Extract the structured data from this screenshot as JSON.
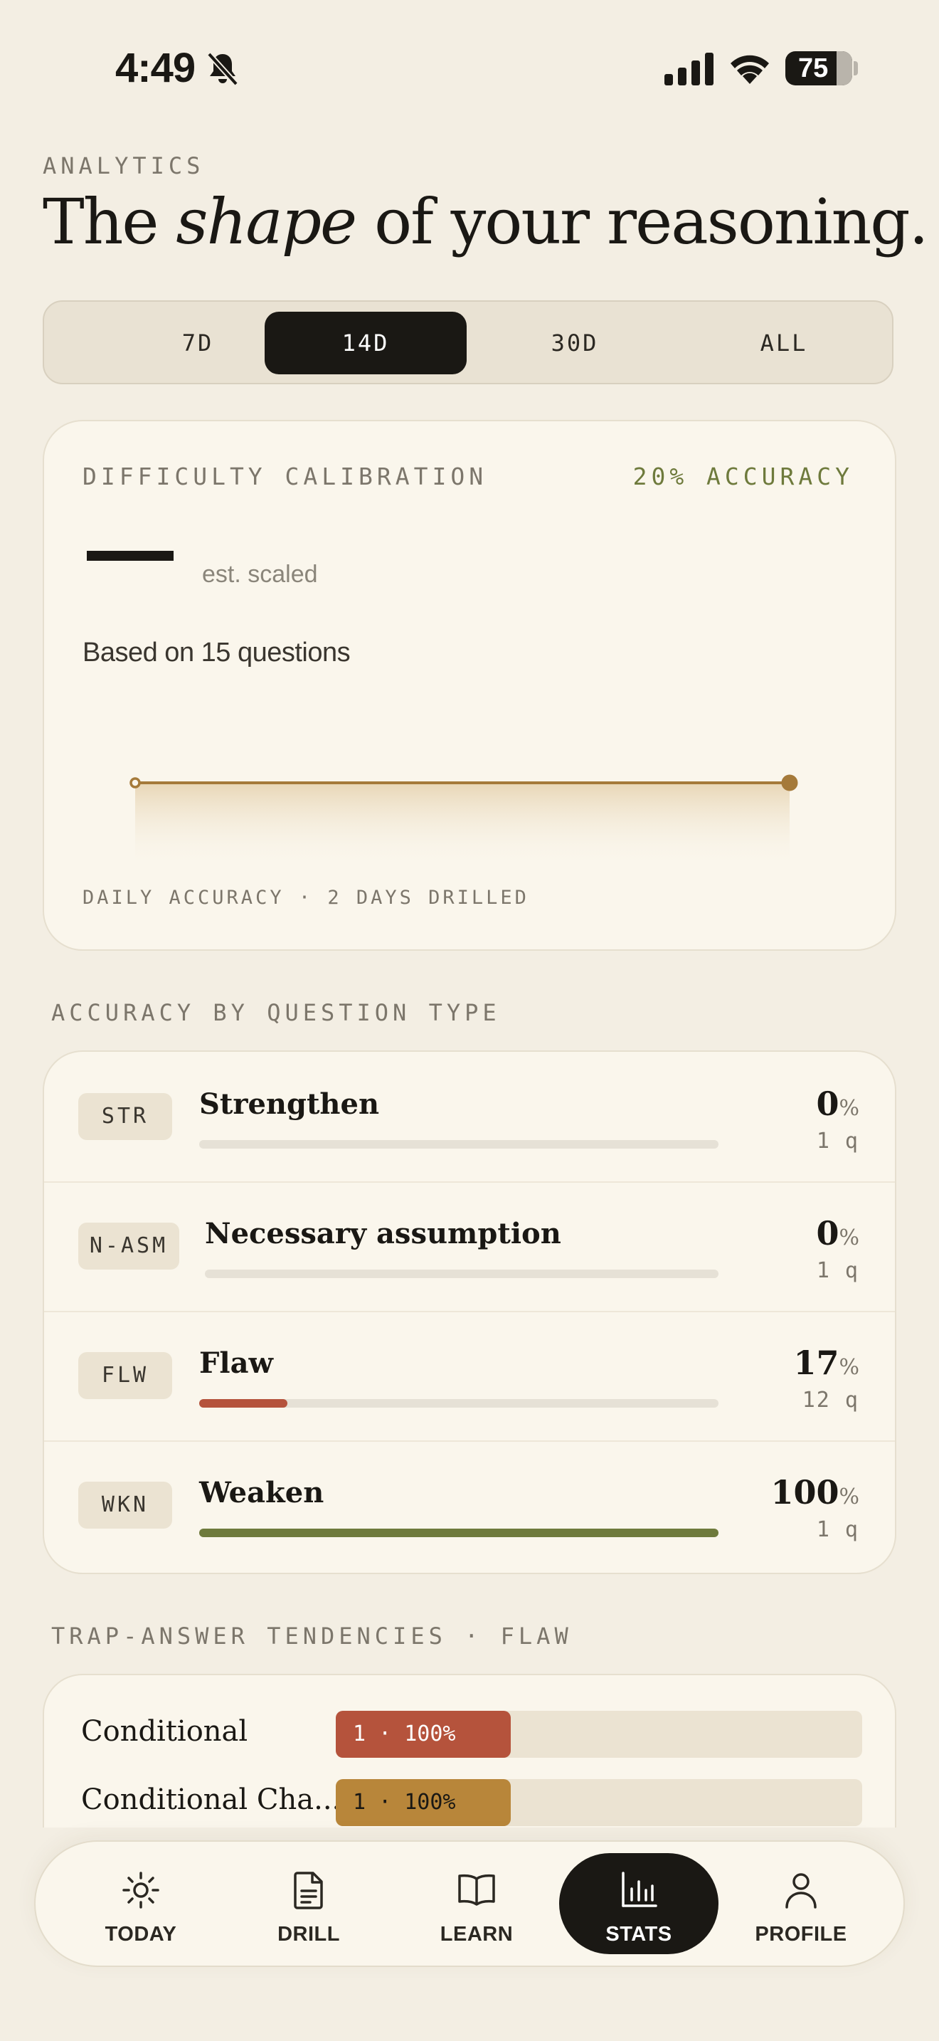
{
  "status_bar": {
    "time": "4:49",
    "battery": "75"
  },
  "header": {
    "eyebrow": "ANALYTICS",
    "title_before": "The ",
    "title_emph": "shape",
    "title_after": " of your reasoning."
  },
  "range_tabs": [
    {
      "label": "7D",
      "active": false
    },
    {
      "label": "14D",
      "active": true
    },
    {
      "label": "30D",
      "active": false
    },
    {
      "label": "ALL",
      "active": false
    }
  ],
  "calibration": {
    "label": "DIFFICULTY CALIBRATION",
    "accuracy": "20% ACCURACY",
    "est_label": "est. scaled",
    "based_on": "Based on 15 questions",
    "footer": "DAILY ACCURACY · 2 DAYS DRILLED",
    "chart_color": "#a57a3a"
  },
  "chart_data": {
    "type": "area",
    "x": [
      "day 1",
      "day 2"
    ],
    "series": [
      {
        "values": [
          20,
          20
        ]
      }
    ],
    "xlabel": "DAILY ACCURACY · 2 DAYS DRILLED",
    "grid": false
  },
  "question_types": {
    "section_label": "ACCURACY BY QUESTION TYPE",
    "rows": [
      {
        "tag": "STR",
        "name": "Strengthen",
        "pct": "0",
        "pct_sym": "%",
        "count": "1 q",
        "fill": 0.0,
        "color": "#d8d2c5"
      },
      {
        "tag": "N-ASM",
        "name": "Necessary assumption",
        "pct": "0",
        "pct_sym": "%",
        "count": "1 q",
        "fill": 0.0,
        "color": "#d8d2c5"
      },
      {
        "tag": "FLW",
        "name": "Flaw",
        "pct": "17",
        "pct_sym": "%",
        "count": "12 q",
        "fill": 0.17,
        "color": "#b5533c"
      },
      {
        "tag": "WKN",
        "name": "Weaken",
        "pct": "100",
        "pct_sym": "%",
        "count": "1 q",
        "fill": 1.0,
        "color": "#6e7a3c"
      }
    ]
  },
  "traps": {
    "section_label": "TRAP-ANSWER TENDENCIES · FLAW",
    "rows": [
      {
        "name": "Conditional",
        "value": "1 · 100%",
        "color": "#b5533c",
        "text_color": "#ffffff"
      },
      {
        "name": "Conditional Cha...",
        "value": "1 · 100%",
        "color": "#b8863a",
        "text_color": "#1a1814"
      }
    ]
  },
  "tabbar": [
    {
      "label": "TODAY",
      "icon": "sun-icon",
      "active": false
    },
    {
      "label": "DRILL",
      "icon": "document-icon",
      "active": false
    },
    {
      "label": "LEARN",
      "icon": "book-icon",
      "active": false
    },
    {
      "label": "STATS",
      "icon": "bar-chart-icon",
      "active": true
    },
    {
      "label": "PROFILE",
      "icon": "person-icon",
      "active": false
    }
  ]
}
